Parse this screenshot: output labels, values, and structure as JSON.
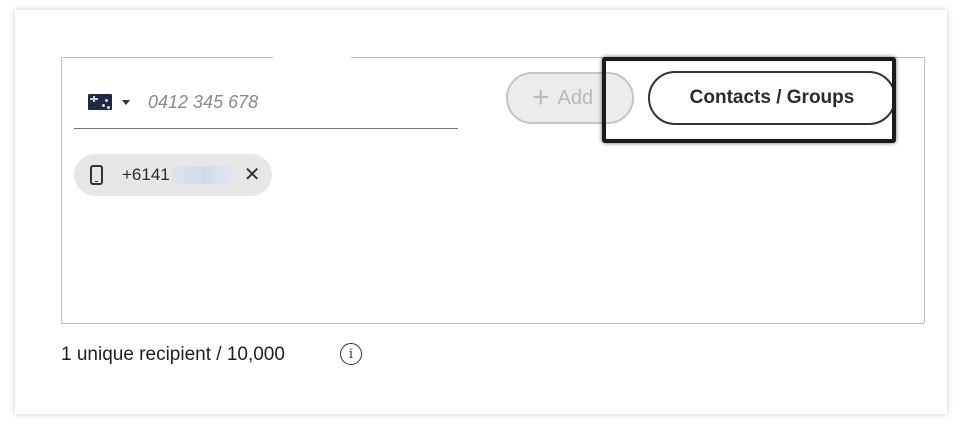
{
  "phone_entry": {
    "country_flag": "australia-flag-icon",
    "placeholder": "0412 345 678",
    "value": ""
  },
  "buttons": {
    "add_label": "Add",
    "add_icon": "plus-icon",
    "contacts_groups_label": "Contacts / Groups"
  },
  "recipients": [
    {
      "icon": "mobile-phone-icon",
      "number_visible": "+6141",
      "number_redacted": true,
      "remove_icon": "close-icon",
      "remove_glyph": "✕"
    }
  ],
  "footer": {
    "recipient_count_text": "1 unique recipient / 10,000",
    "info_icon": "info-icon",
    "info_glyph": "i"
  },
  "colors": {
    "highlight_frame": "#1b1b1b",
    "chip_background": "#e7e7e7",
    "disabled_button_background": "#ececec"
  }
}
